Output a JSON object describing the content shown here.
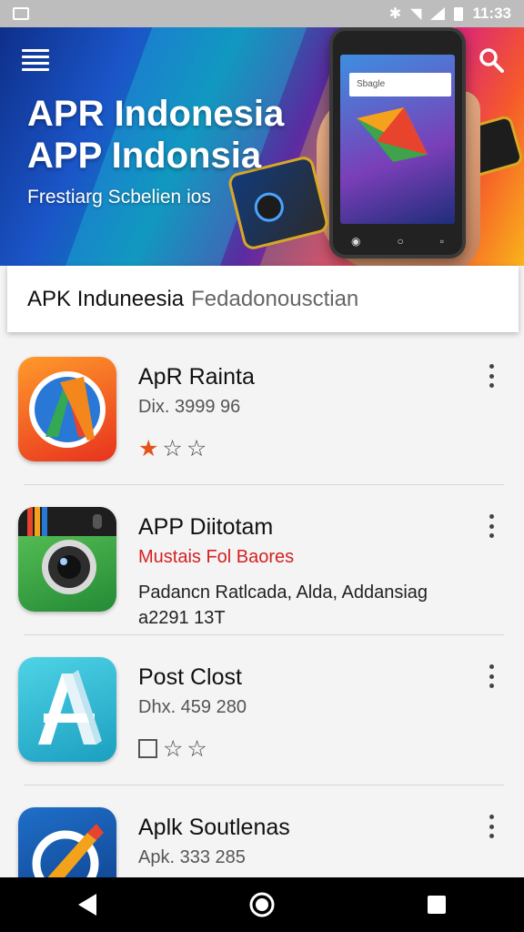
{
  "status_bar": {
    "time": "11:33"
  },
  "hero": {
    "title_line1": "APR Indonesia",
    "title_line2": "APP Indonsia",
    "subtitle": "Frestiarg Scbelien ios",
    "phone_search_text": "Sbagle"
  },
  "search": {
    "query": "APK Induneesia",
    "placeholder": "Fedadonousctian"
  },
  "apps": [
    {
      "title": "ApR Rainta",
      "subtitle": "Dix. 3999 96",
      "rating": 1,
      "rating_max": 3
    },
    {
      "title": "APP Diitotam",
      "subtitle": "Mustais Fol Baores",
      "description": "Padancn Ratlcada, Alda, Addansiag a2291 13T"
    },
    {
      "title": "Post Clost",
      "subtitle": "Dhx. 459 280",
      "rating": 0,
      "rating_max": 3,
      "has_checkbox": true
    },
    {
      "title": "Aplk Soutlenas",
      "subtitle": "Apk. 333 285"
    }
  ],
  "colors": {
    "accent_orange": "#e3541b",
    "subtitle_red": "#d32222",
    "dot_active": "#ffffff",
    "dot_red": "#e53935",
    "dot_inactive": "#2f5fa8"
  },
  "icons": {
    "menu": "hamburger-menu-icon",
    "search": "search-icon",
    "more": "more-vertical-icon",
    "nav_back": "back-triangle-icon",
    "nav_home": "home-circle-icon",
    "nav_recents": "recents-square-icon"
  }
}
